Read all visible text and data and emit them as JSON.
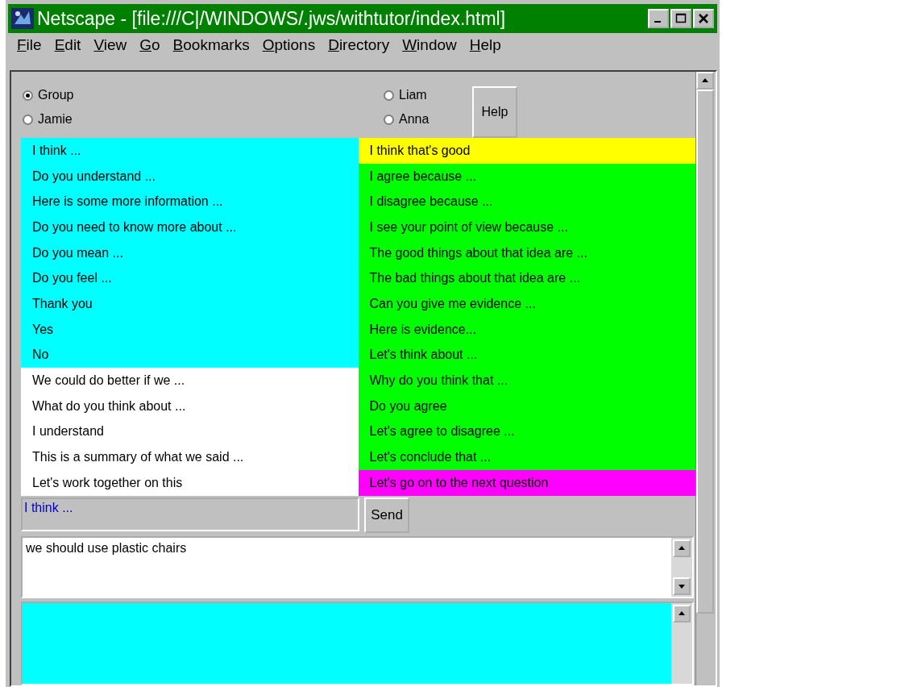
{
  "window": {
    "title": "Netscape - [file:///C|/WINDOWS/.jws/withtutor/index.html]"
  },
  "menu": [
    "File",
    "Edit",
    "View",
    "Go",
    "Bookmarks",
    "Options",
    "Directory",
    "Window",
    "Help"
  ],
  "recipients_left": [
    {
      "label": "Group",
      "selected": true
    },
    {
      "label": "Jamie",
      "selected": false
    }
  ],
  "recipients_right": [
    {
      "label": "Liam",
      "selected": false
    },
    {
      "label": "Anna",
      "selected": false
    }
  ],
  "help_button": "Help",
  "phrases_left": [
    {
      "text": "I think ...",
      "color": "#00ffff"
    },
    {
      "text": "Do you understand ...",
      "color": "#00ffff"
    },
    {
      "text": "Here is some more information ...",
      "color": "#00ffff"
    },
    {
      "text": "Do you need to know more about ...",
      "color": "#00ffff"
    },
    {
      "text": "Do you mean ...",
      "color": "#00ffff"
    },
    {
      "text": "Do you feel ...",
      "color": "#00ffff"
    },
    {
      "text": "Thank you",
      "color": "#00ffff"
    },
    {
      "text": "Yes",
      "color": "#00ffff"
    },
    {
      "text": "No",
      "color": "#00ffff"
    },
    {
      "text": "We could do better if we ...",
      "color": "#ffffff"
    },
    {
      "text": "What do you think about ...",
      "color": "#ffffff"
    },
    {
      "text": "I understand",
      "color": "#ffffff"
    },
    {
      "text": "This is a summary of what we said ...",
      "color": "#ffffff"
    },
    {
      "text": "Let's work together on this",
      "color": "#ffffff"
    }
  ],
  "phrases_right": [
    {
      "text": "I think that's good",
      "color": "#ffff00"
    },
    {
      "text": "I agree because ...",
      "color": "#00ff00"
    },
    {
      "text": "I disagree because ...",
      "color": "#00ff00"
    },
    {
      "text": "I see your point of view because ...",
      "color": "#00ff00"
    },
    {
      "text": "The good things about that idea are ...",
      "color": "#00ff00"
    },
    {
      "text": "The bad things about that idea are ...",
      "color": "#00ff00"
    },
    {
      "text": "Can you give me evidence ...",
      "color": "#00ff00"
    },
    {
      "text": "Here is evidence...",
      "color": "#00ff00"
    },
    {
      "text": "Let's think about ...",
      "color": "#00ff00"
    },
    {
      "text": "Why do you think that ...",
      "color": "#00ff00"
    },
    {
      "text": "Do you agree",
      "color": "#00ff00"
    },
    {
      "text": "Let's agree to disagree ...",
      "color": "#00ff00"
    },
    {
      "text": "Let's conclude that ...",
      "color": "#00ff00"
    },
    {
      "text": "Let's go on to the next question",
      "color": "#ff00ff"
    }
  ],
  "composer": {
    "value": "I think ..."
  },
  "send_button": "Send",
  "message_box": {
    "value": "we should use plastic chairs"
  }
}
